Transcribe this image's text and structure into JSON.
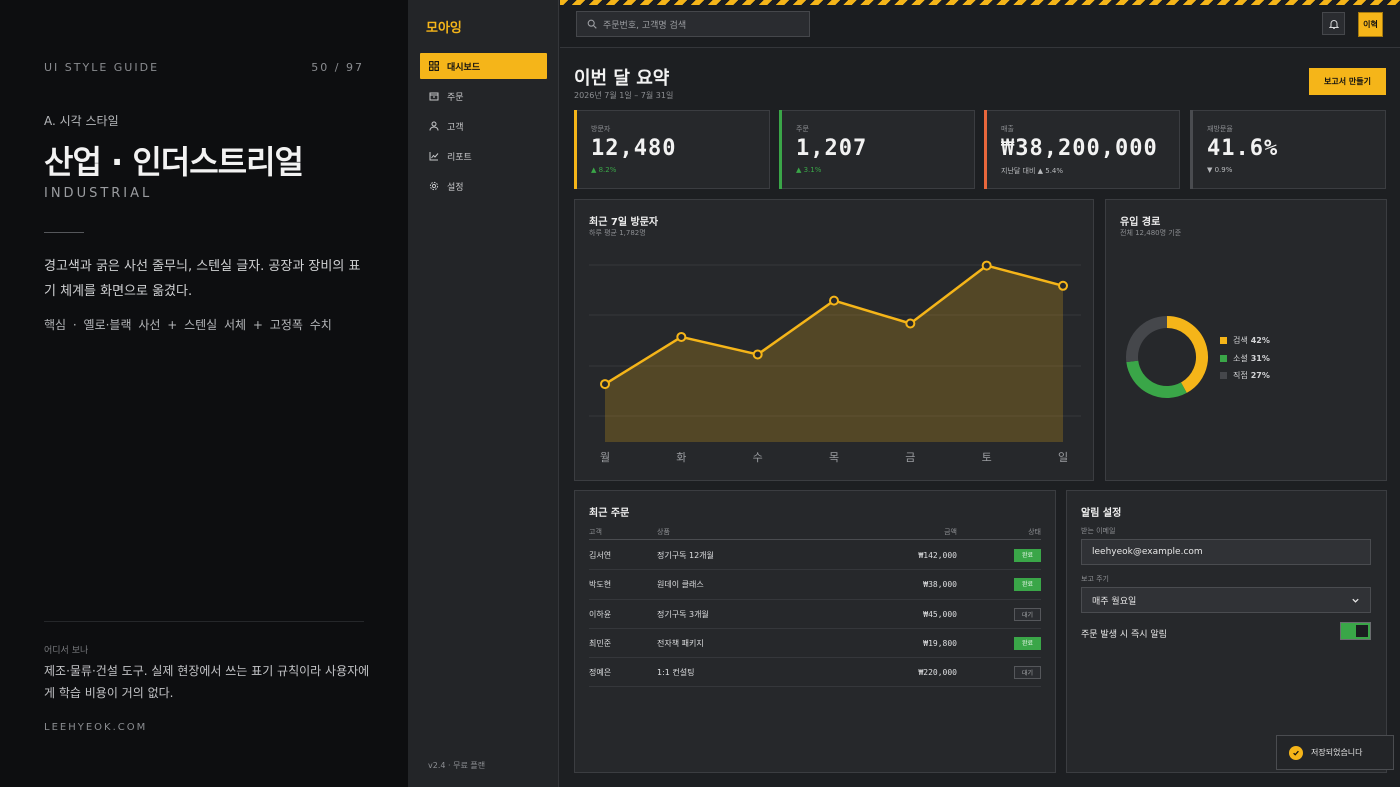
{
  "guide": {
    "label": "UI STYLE GUIDE",
    "page": "50 / 97",
    "section": "A. 시각 스타일",
    "title": "산업 · 인더스트리얼",
    "subtitle": "INDUSTRIAL",
    "description": "경고색과 굵은 사선 줄무늬, 스텐실 글자. 공장과 장비의 표기 체계를 화면으로 옮겼다.",
    "core": "핵심 · 옐로·블랙 사선 + 스텐실 서체 + 고정폭 수치",
    "where_label": "어디서 보나",
    "where_text": "제조·물류·건설 도구. 실제 현장에서 쓰는 표기 규칙이라 사용자에게 학습 비용이 거의 없다.",
    "site": "LEEHYEOK.COM"
  },
  "app": {
    "brand": "모아잉",
    "nav": [
      {
        "label": "대시보드",
        "icon": "grid-icon",
        "active": true
      },
      {
        "label": "주문",
        "icon": "box-icon",
        "active": false
      },
      {
        "label": "고객",
        "icon": "user-icon",
        "active": false
      },
      {
        "label": "리포트",
        "icon": "chart-icon",
        "active": false
      },
      {
        "label": "설정",
        "icon": "gear-icon",
        "active": false
      }
    ],
    "version": "v2.4 · 무료 플랜",
    "search_placeholder": "주문번호, 고객명 검색",
    "user_initials": "이혁",
    "accent": "#f5b519"
  },
  "summary": {
    "title": "이번 달 요약",
    "date_range": "2026년 7월 1일 – 7월 31일",
    "report_button": "보고서 만들기"
  },
  "kpis": [
    {
      "label": "방문자",
      "value": "12,480",
      "delta": "▲ 8.2%",
      "color": "#f5b519",
      "delta_color": "#3aa648"
    },
    {
      "label": "주문",
      "value": "1,207",
      "delta": "▲ 3.1%",
      "color": "#3aa648",
      "delta_color": "#3aa648"
    },
    {
      "label": "매출",
      "value": "₩38,200,000",
      "delta": "지난달 대비 ▲ 5.4%",
      "color": "#e8673c",
      "delta_color": "#b8babd"
    },
    {
      "label": "재방문율",
      "value": "41.6%",
      "delta": "▼ 0.9%",
      "color": "#4a4c50",
      "delta_color": "#b8babd"
    }
  ],
  "visitors": {
    "title": "최근 7일 방문자",
    "subtitle": "하루 평균 1,782명"
  },
  "chart_data": [
    {
      "type": "area",
      "categories": [
        "월",
        "화",
        "수",
        "목",
        "금",
        "토",
        "일"
      ],
      "values": [
        1230,
        1580,
        1450,
        1850,
        1680,
        2110,
        1960
      ],
      "ylim": [
        800,
        2300
      ],
      "grid": true,
      "color": "#f5b519"
    },
    {
      "type": "pie",
      "categories": [
        "검색",
        "소셜",
        "직접"
      ],
      "values": [
        42,
        31,
        27
      ],
      "colors": [
        "#f5b519",
        "#3aa648",
        "#45474b"
      ]
    }
  ],
  "sources": {
    "title": "유입 경로",
    "subtitle": "전체 12,480명 기준",
    "legend": [
      {
        "name": "검색",
        "pct": "42%",
        "color": "#f5b519"
      },
      {
        "name": "소셜",
        "pct": "31%",
        "color": "#3aa648"
      },
      {
        "name": "직접",
        "pct": "27%",
        "color": "#45474b"
      }
    ]
  },
  "orders": {
    "title": "최근 주문",
    "columns": [
      "고객",
      "상품",
      "금액",
      "상태"
    ],
    "rows": [
      {
        "customer": "김서연",
        "product": "정기구독 12개월",
        "amount": "₩142,000",
        "status": "완료",
        "kind": "done"
      },
      {
        "customer": "박도현",
        "product": "원데이 클래스",
        "amount": "₩38,000",
        "status": "완료",
        "kind": "done"
      },
      {
        "customer": "이하윤",
        "product": "정기구독 3개월",
        "amount": "₩45,000",
        "status": "대기",
        "kind": "wait"
      },
      {
        "customer": "최민준",
        "product": "전자책 패키지",
        "amount": "₩19,800",
        "status": "완료",
        "kind": "done"
      },
      {
        "customer": "정예은",
        "product": "1:1 컨설팅",
        "amount": "₩220,000",
        "status": "대기",
        "kind": "wait"
      }
    ]
  },
  "alerts": {
    "title": "알림 설정",
    "email_label": "받는 이메일",
    "email_value": "leehyeok@example.com",
    "period_label": "보고 주기",
    "period_value": "매주 월요일",
    "toggle_label": "주문 발생 시 즉시 알림",
    "toggle_on": true
  },
  "toast": {
    "message": "저장되었습니다"
  }
}
